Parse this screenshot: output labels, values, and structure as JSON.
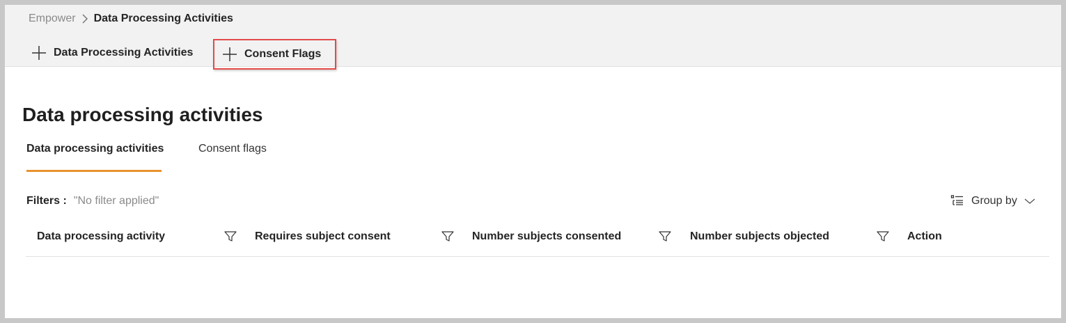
{
  "breadcrumb": {
    "root": "Empower",
    "current": "Data Processing Activities"
  },
  "commands": {
    "add_dpa_label": "Data Processing Activities",
    "add_consent_label": "Consent Flags",
    "highlight_color": "#e34a4a"
  },
  "page": {
    "title": "Data processing activities"
  },
  "tabs": [
    {
      "label": "Data processing activities",
      "active": true
    },
    {
      "label": "Consent flags",
      "active": false
    }
  ],
  "filters": {
    "label": "Filters :",
    "value": "\"No filter applied\""
  },
  "group_by": {
    "label": "Group by"
  },
  "table": {
    "columns": [
      {
        "label": "Data processing activity",
        "filterable": true
      },
      {
        "label": "Requires subject consent",
        "filterable": true
      },
      {
        "label": "Number subjects consented",
        "filterable": true
      },
      {
        "label": "Number subjects objected",
        "filterable": true
      },
      {
        "label": "Action",
        "filterable": false
      }
    ],
    "rows": []
  },
  "colors": {
    "accent_tab_underline": "#e8922d",
    "topbar_bg": "#f2f2f2"
  }
}
